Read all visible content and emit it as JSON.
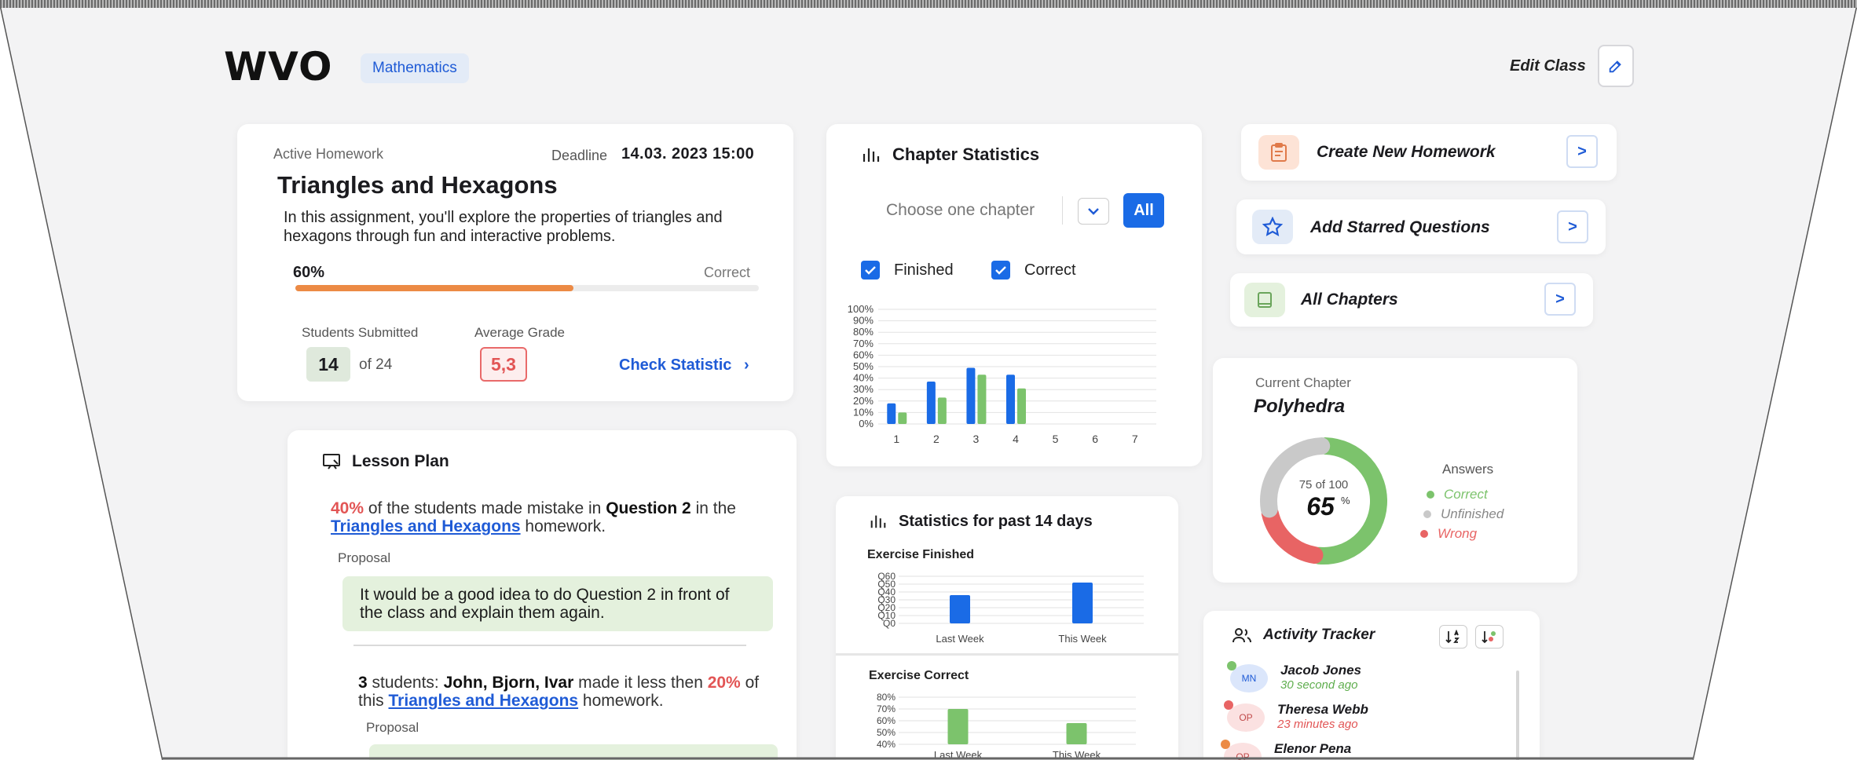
{
  "header": {
    "logo": "WVO",
    "subject": "Mathematics",
    "edit_class": "Edit Class"
  },
  "homework": {
    "label": "Active Homework",
    "deadline_label": "Deadline",
    "deadline": "14.03. 2023 15:00",
    "title": "Triangles and Hexagons",
    "description": "In this assignment, you'll explore the properties of triangles and hexagons through fun and interactive problems.",
    "progress_label": "60%",
    "progress": 0.6,
    "correct_label": "Correct",
    "submitted_label": "Students Submitted",
    "submitted_count": "14",
    "submitted_total": "of 24",
    "grade_label": "Average Grade",
    "grade": "5,3",
    "check_link": "Check Statistic"
  },
  "lesson_plan": {
    "title": "Lesson Plan",
    "item1": {
      "percent": "40%",
      "text_a": " of the students made mistake in ",
      "question": "Question 2",
      "text_b": " in the ",
      "link": "Triangles and Hexagons",
      "text_c": " homework.",
      "proposal_label": "Proposal",
      "proposal": "It would be a good idea to do Question 2 in front of the class and explain them again."
    },
    "item2": {
      "count": "3",
      "text_a": " students: ",
      "names": "John, Bjorn, Ivar",
      "text_b": "  made it less then ",
      "percent": "20%",
      "text_c": " of this ",
      "link": "Triangles and Hexagons",
      "text_d": " homework.",
      "proposal_label": "Proposal"
    }
  },
  "chapter_stats": {
    "title": "Chapter Statistics",
    "select_placeholder": "Choose one chapter",
    "all_button": "All",
    "check_finished": "Finished",
    "check_correct": "Correct"
  },
  "past_days": {
    "title": "Statistics for past 14 days",
    "finished_title": "Exercise Finished",
    "correct_title": "Exercise Correct"
  },
  "actions": [
    {
      "label": "Create New Homework",
      "icon": "clipboard-icon",
      "button": ">"
    },
    {
      "label": "Add Starred Questions",
      "icon": "star-icon",
      "button": ">"
    },
    {
      "label": "All Chapters",
      "icon": "book-icon",
      "button": ">"
    }
  ],
  "current_chapter": {
    "label": "Current Chapter",
    "title": "Polyhedra",
    "of_label": "75 of 100",
    "percent": "65",
    "percent_sign": "%",
    "legend_title": "Answers",
    "legend": [
      {
        "label": "Correct",
        "color": "#7cc36c"
      },
      {
        "label": "Unfinished",
        "color": "#c9c9c9"
      },
      {
        "label": "Wrong",
        "color": "#e86464"
      }
    ],
    "segments": {
      "correct": 0.52,
      "unfinished": 0.28,
      "wrong": 0.2
    }
  },
  "activity": {
    "title": "Activity Tracker",
    "rows": [
      {
        "initials": "MN",
        "name": "Jacob Jones",
        "time": "30 second ago",
        "time_color": "#5fae4e",
        "avatar_bg": "#dbe6fb",
        "dot": "#7cc36c"
      },
      {
        "initials": "OP",
        "name": "Theresa Webb",
        "time": "23 minutes ago",
        "time_color": "#e25555",
        "avatar_bg": "#fbe1e1",
        "dot": "#e86464"
      },
      {
        "initials": "OP",
        "name": "Elenor Pena",
        "time": "",
        "time_color": "#e25555",
        "avatar_bg": "#fbe1e1",
        "dot": "#ec8a45"
      }
    ]
  },
  "chart_data": [
    {
      "type": "bar",
      "title": "Chapter Statistics",
      "categories": [
        "1",
        "2",
        "3",
        "4",
        "5",
        "6",
        "7"
      ],
      "series": [
        {
          "name": "Finished",
          "values": [
            18,
            37,
            49,
            43,
            0,
            0,
            0
          ],
          "color": "#1a6be6"
        },
        {
          "name": "Correct",
          "values": [
            10,
            23,
            43,
            31,
            0,
            0,
            0
          ],
          "color": "#7cc36c"
        }
      ],
      "yticks": [
        "100%",
        "90%",
        "80%",
        "70%",
        "60%",
        "50%",
        "40%",
        "30%",
        "20%",
        "10%",
        "0%"
      ],
      "ylim": [
        0,
        100
      ],
      "grid": true
    },
    {
      "type": "bar",
      "title": "Exercise Finished",
      "categories": [
        "Last Week",
        "This Week"
      ],
      "values": [
        36,
        52
      ],
      "yticks": [
        "Q60",
        "Q50",
        "Q40",
        "Q30",
        "Q20",
        "Q10",
        "Q0"
      ],
      "ylim": [
        0,
        60
      ],
      "color": "#1a6be6",
      "grid": true
    },
    {
      "type": "bar",
      "title": "Exercise Correct",
      "categories": [
        "Last Week",
        "This Week"
      ],
      "values": [
        70,
        58
      ],
      "yticks": [
        "80%",
        "70%",
        "60%",
        "50%",
        "40%"
      ],
      "ylim": [
        40,
        80
      ],
      "color": "#7cc36c",
      "grid": true
    }
  ]
}
